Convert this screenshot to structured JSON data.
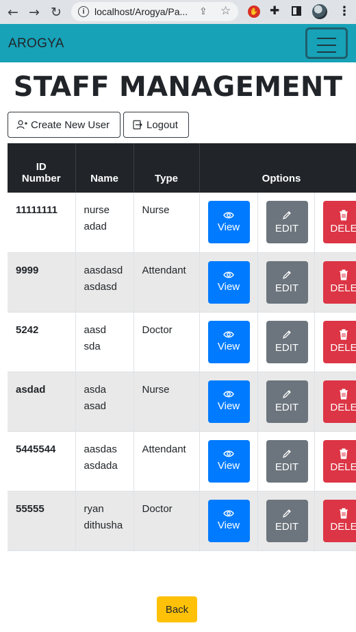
{
  "browser": {
    "url": "localhost/Arogya/Pa...",
    "back_icon": "arrow-left-icon",
    "forward_icon": "arrow-right-icon",
    "reload_icon": "reload-icon"
  },
  "navbar": {
    "brand": "AROGYA",
    "menu_icon": "hamburger-icon",
    "color": "#17a2b8"
  },
  "page": {
    "title": "STAFF MANAGEMENT",
    "create_user_label": "Create New User",
    "logout_label": "Logout",
    "back_label": "Back"
  },
  "table": {
    "headers": {
      "id_line1": "ID",
      "id_line2": "Number",
      "name": "Name",
      "type": "Type",
      "options": "Options"
    },
    "actions": {
      "view": "View",
      "edit": "EDIT",
      "delete": "DELE"
    },
    "rows": [
      {
        "id": "11111111",
        "name1": "nurse",
        "name2": "adad",
        "type": "Nurse"
      },
      {
        "id": "9999",
        "name1": "aasdasd",
        "name2": "asdasd",
        "type": "Attendant"
      },
      {
        "id": "5242",
        "name1": "aasd",
        "name2": "sda",
        "type": "Doctor"
      },
      {
        "id": "asdad",
        "name1": "asda",
        "name2": "asad",
        "type": "Nurse"
      },
      {
        "id": "5445544",
        "name1": "aasdas",
        "name2": "asdada",
        "type": "Attendant"
      },
      {
        "id": "55555",
        "name1": "ryan",
        "name2": "dithusha",
        "type": "Doctor"
      }
    ]
  },
  "colors": {
    "view": "#007bff",
    "edit": "#6c757d",
    "delete": "#dc3545",
    "back": "#ffc107",
    "header": "#212529"
  }
}
